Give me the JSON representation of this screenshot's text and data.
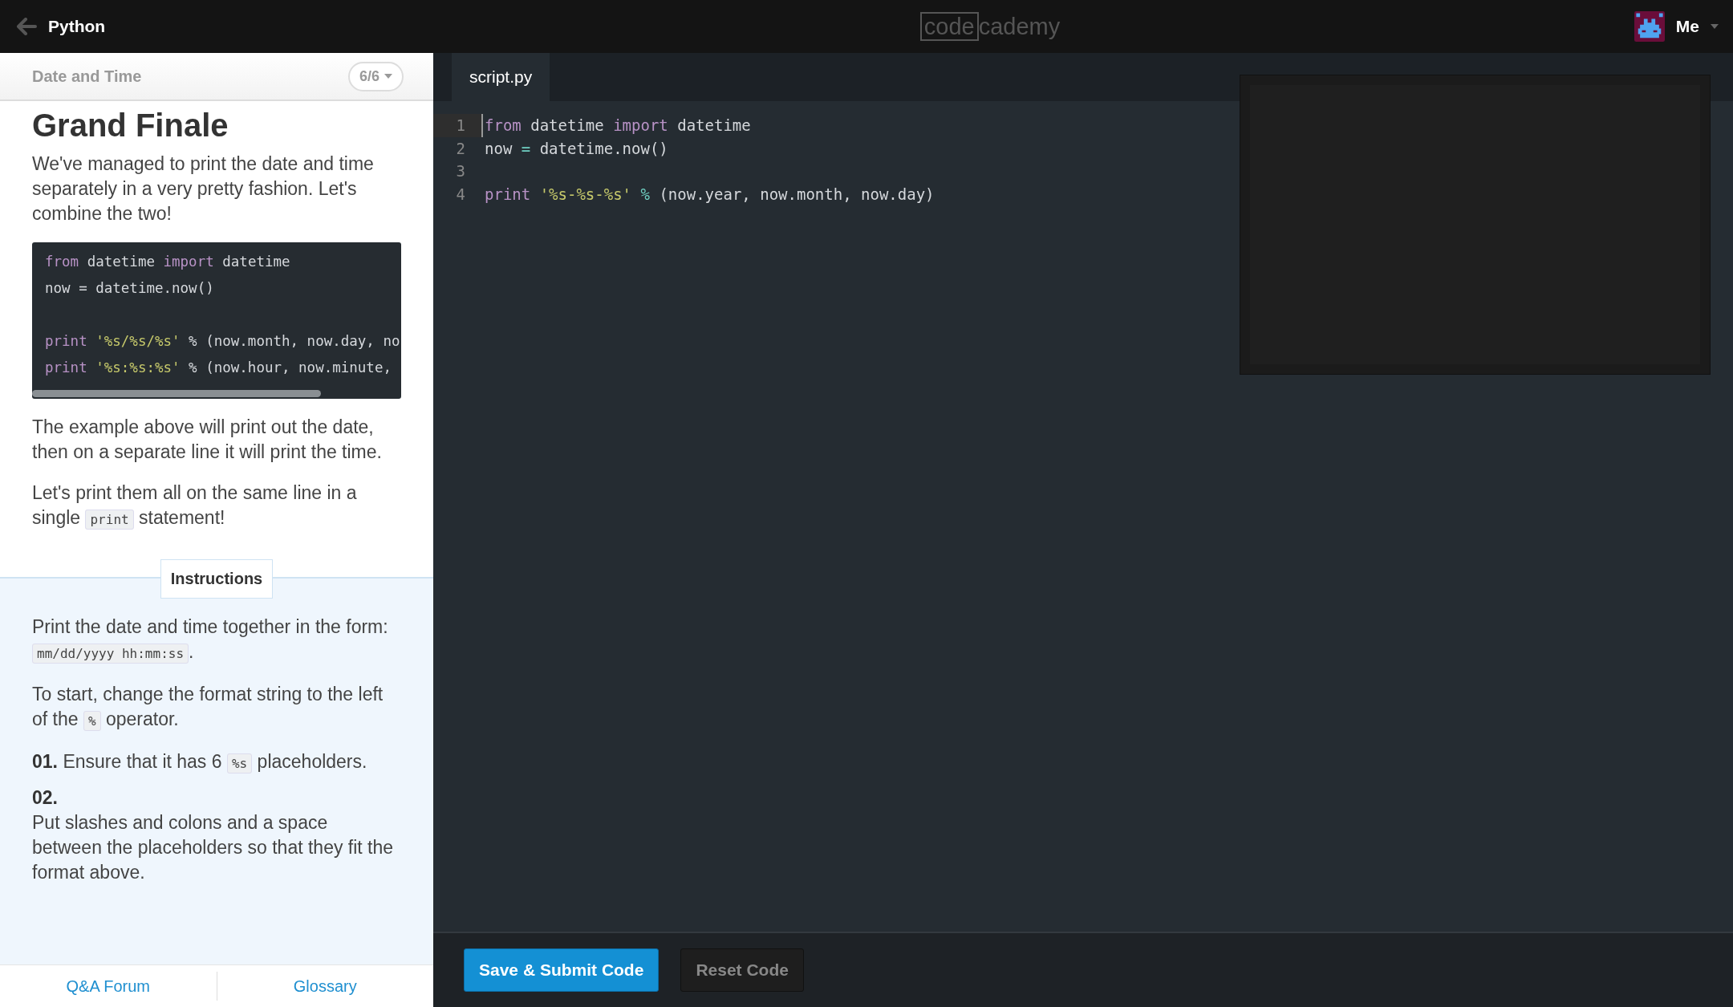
{
  "top_bar": {
    "back_label": "Python",
    "logo": {
      "boxed": "code",
      "rest": "cademy"
    },
    "user": {
      "label": "Me"
    }
  },
  "lesson_header": {
    "title": "Date and Time",
    "progress": "6/6"
  },
  "lesson": {
    "title": "Grand Finale",
    "paragraphs_before": [
      {
        "parts": [
          {
            "kind": "text",
            "text": "We've managed to print the date and time separately in a very pretty fashion. Let's combine the two!"
          }
        ]
      }
    ],
    "example_code": [
      {
        "kind": "code",
        "tokens": [
          {
            "kind": "keyword",
            "text": "from"
          },
          {
            "kind": "plain",
            "text": " datetime "
          },
          {
            "kind": "keyword",
            "text": "import"
          },
          {
            "kind": "plain",
            "text": " datetime"
          }
        ]
      },
      {
        "kind": "code",
        "tokens": [
          {
            "kind": "plain",
            "text": "now = datetime.now()"
          }
        ]
      },
      {
        "kind": "blank"
      },
      {
        "kind": "code",
        "tokens": [
          {
            "kind": "keyword",
            "text": "print "
          },
          {
            "kind": "string",
            "text": "'%s/%s/%s'"
          },
          {
            "kind": "plain",
            "text": " % (now.month, now.day, no"
          }
        ]
      },
      {
        "kind": "code",
        "tokens": [
          {
            "kind": "keyword",
            "text": "print "
          },
          {
            "kind": "string",
            "text": "'%s:%s:%s'"
          },
          {
            "kind": "plain",
            "text": " % (now.hour, now.minute,"
          }
        ]
      }
    ],
    "paragraphs_after": [
      {
        "parts": [
          {
            "kind": "text",
            "text": "The example above will print out the date, then on a separate line it will print the time."
          }
        ]
      },
      {
        "parts": [
          {
            "kind": "text",
            "text": "Let's print them all on the same line in a single "
          },
          {
            "kind": "code",
            "text": "print"
          },
          {
            "kind": "text",
            "text": " statement!"
          }
        ]
      }
    ]
  },
  "instructions": {
    "label": "Instructions",
    "paragraphs": [
      {
        "parts": [
          {
            "kind": "text",
            "text": "Print the date and time together in the form: "
          },
          {
            "kind": "code",
            "text": "mm/dd/yyyy hh:mm:ss"
          },
          {
            "kind": "text",
            "text": "."
          }
        ]
      },
      {
        "parts": [
          {
            "kind": "text",
            "text": "To start, change the format string to the left of the "
          },
          {
            "kind": "code",
            "text": "%"
          },
          {
            "kind": "text",
            "text": " operator."
          }
        ]
      }
    ],
    "steps": [
      {
        "number": "01.",
        "block": false,
        "parts": [
          {
            "kind": "text",
            "text": "Ensure that it has 6 "
          },
          {
            "kind": "code",
            "text": "%s"
          },
          {
            "kind": "text",
            "text": " placeholders."
          }
        ]
      },
      {
        "number": "02.",
        "block": true,
        "parts": [
          {
            "kind": "text",
            "text": "Put slashes and colons and a space between the placeholders so that they fit the format above."
          }
        ]
      }
    ]
  },
  "footer_links": [
    "Q&A Forum",
    "Glossary"
  ],
  "editor": {
    "tabs": [
      {
        "label": "script.py",
        "selected": true
      }
    ],
    "lines": [
      {
        "number": "1",
        "active": true,
        "tokens": [
          {
            "kind": "keyword",
            "text": "from"
          },
          {
            "kind": "plain",
            "text": " datetime "
          },
          {
            "kind": "keyword",
            "text": "import"
          },
          {
            "kind": "plain",
            "text": " datetime"
          }
        ]
      },
      {
        "number": "2",
        "active": false,
        "tokens": [
          {
            "kind": "plain",
            "text": "now "
          },
          {
            "kind": "operator",
            "text": "="
          },
          {
            "kind": "plain",
            "text": " datetime.now()"
          }
        ]
      },
      {
        "number": "3",
        "active": false
      },
      {
        "number": "4",
        "active": false,
        "tokens": [
          {
            "kind": "keyword",
            "text": "print "
          },
          {
            "kind": "string",
            "text": "'%s-%s-%s' "
          },
          {
            "kind": "operator",
            "text": "%"
          },
          {
            "kind": "plain",
            "text": " (now.year, now.month, now.day)"
          }
        ]
      }
    ]
  },
  "buttons": [
    {
      "kind": "primary",
      "label": "Save & Submit Code"
    },
    {
      "kind": "secondary",
      "label": "Reset Code"
    }
  ]
}
